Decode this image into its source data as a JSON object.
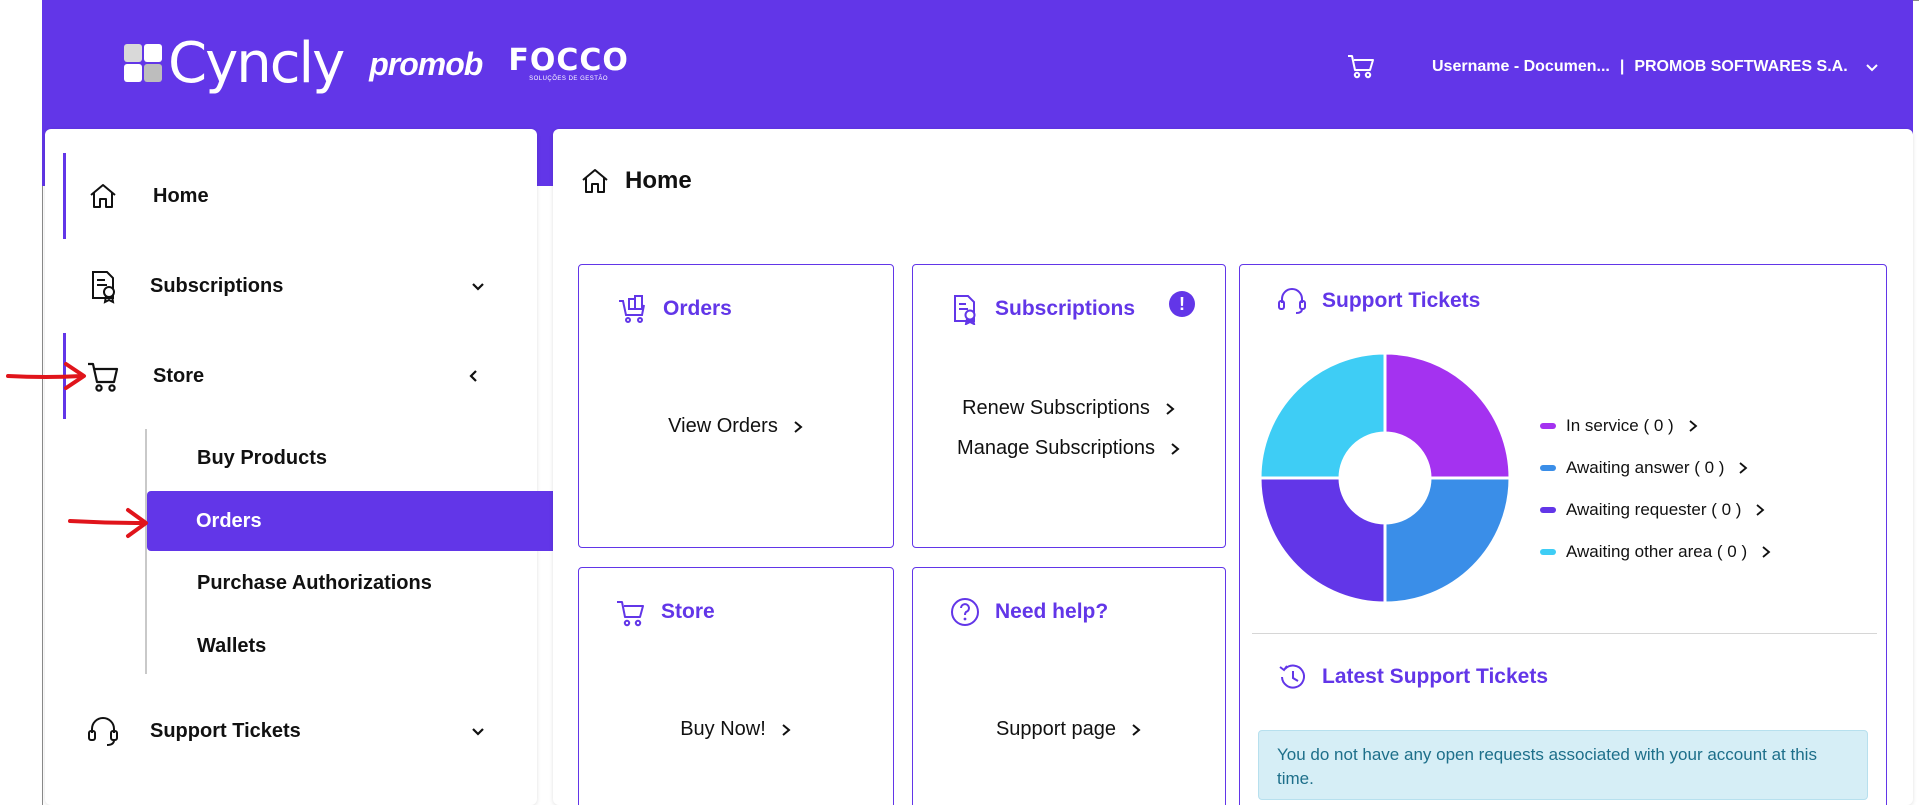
{
  "header": {
    "brand_cyncly": "Cyncly",
    "brand_promob": "promob",
    "brand_focco": "FOCCO",
    "brand_focco_sub": "SOLUÇÕES DE GESTÃO",
    "user_name": "Username - Documen...",
    "separator": "|",
    "company": "PROMOB SOFTWARES S.A.",
    "accent_color": "#6236e8"
  },
  "sidebar": {
    "items": [
      {
        "label": "Home",
        "icon": "home-icon"
      },
      {
        "label": "Subscriptions",
        "icon": "subscription-icon"
      },
      {
        "label": "Store",
        "icon": "cart-icon"
      },
      {
        "label": "Support Tickets",
        "icon": "headset-icon"
      }
    ],
    "store_sub": [
      {
        "label": "Buy Products"
      },
      {
        "label": "Orders"
      },
      {
        "label": "Purchase Authorizations"
      },
      {
        "label": "Wallets"
      }
    ]
  },
  "main": {
    "title": "Home",
    "cards": {
      "orders": {
        "title": "Orders",
        "link": "View Orders"
      },
      "subscriptions": {
        "title": "Subscriptions",
        "alert": "!",
        "link1": "Renew Subscriptions",
        "link2": "Manage Subscriptions"
      },
      "store": {
        "title": "Store",
        "link": "Buy Now!"
      },
      "help": {
        "title": "Need help?",
        "link": "Support page"
      },
      "support": {
        "title": "Support Tickets",
        "legend": [
          {
            "label": "In service ( 0 )",
            "color": "#a432f0"
          },
          {
            "label": "Awaiting answer ( 0 )",
            "color": "#3a8ee8"
          },
          {
            "label": "Awaiting requester ( 0 )",
            "color": "#6236e8"
          },
          {
            "label": "Awaiting other area ( 0 )",
            "color": "#3ecdf5"
          }
        ],
        "latest_title": "Latest Support Tickets",
        "empty_message": "You do not have any open requests associated with your account at this time."
      }
    }
  }
}
